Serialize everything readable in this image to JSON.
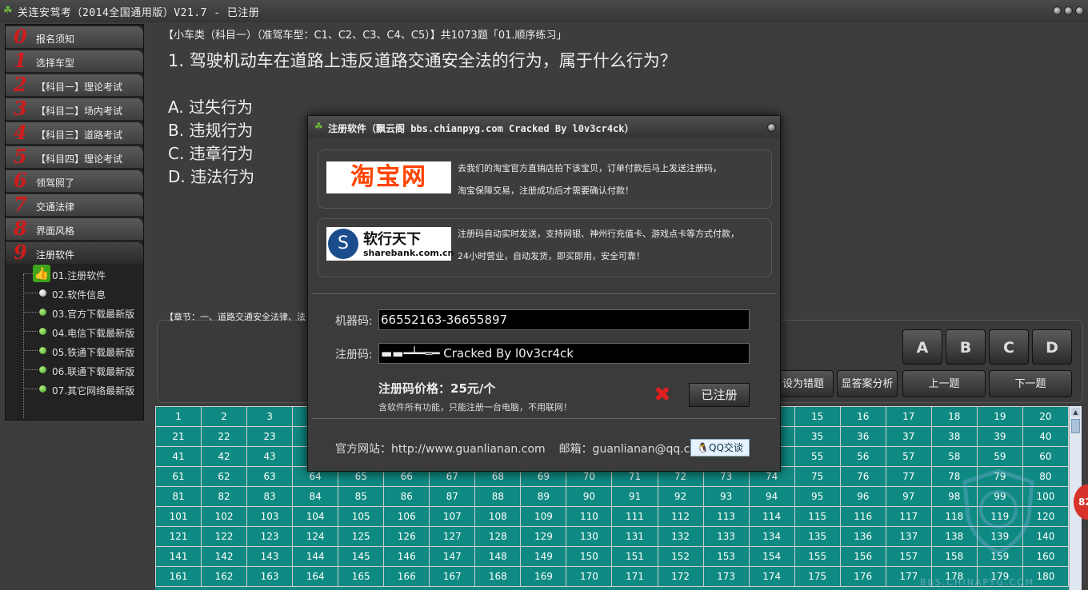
{
  "window": {
    "title": "关连安驾考（2014全国通用版）V21.7 - 已注册"
  },
  "sidebar": {
    "items": [
      {
        "num": "0",
        "label": "报名须知"
      },
      {
        "num": "1",
        "label": "选择车型"
      },
      {
        "num": "2",
        "label": "【科目一】理论考试"
      },
      {
        "num": "3",
        "label": "【科目二】场内考试"
      },
      {
        "num": "4",
        "label": "【科目三】道路考试"
      },
      {
        "num": "5",
        "label": "【科目四】理论考试"
      },
      {
        "num": "6",
        "label": "领驾照了"
      },
      {
        "num": "7",
        "label": "交通法律"
      },
      {
        "num": "8",
        "label": "界面风格"
      },
      {
        "num": "9",
        "label": "注册软件"
      }
    ],
    "subitems": [
      "01.注册软件",
      "02.软件信息",
      "03.官方下载最新版",
      "04.电信下载最新版",
      "05.铁通下载最新版",
      "06.联通下载最新版",
      "07.其它网络最新版"
    ]
  },
  "question": {
    "header": "【小车类（科目一）（准驾车型：C1、C2、C3、C4、C5）】共1073题「01.顺序练习」",
    "text": "1. 驾驶机动车在道路上违反道路交通安全法的行为，属于什么行为？",
    "options": [
      "A. 过失行为",
      "B. 违规行为",
      "C. 违章行为",
      "D. 违法行为"
    ],
    "chapter": "【章节：一、道路交通安全法律、法"
  },
  "answer_buttons": [
    "A",
    "B",
    "C",
    "D"
  ],
  "action_buttons": {
    "mark_wrong": "设为错题",
    "show_analysis": "显答案分析",
    "prev": "上一题",
    "next": "下一题"
  },
  "grid": {
    "start": 1,
    "end": 180,
    "columns": 20
  },
  "badge": {
    "text": "82"
  },
  "watermark": {
    "text": "BBS.CHINAPYG.COM"
  },
  "dialog": {
    "title": "注册软件（飘云阁 bbs.chianpyg.com Cracked By l0v3cr4ck）",
    "taobao_logo": "淘宝网",
    "taobao_line1": "去我们的淘宝官方直销店拍下该宝贝，订单付款后马上发送注册码，",
    "taobao_line2": "淘宝保障交易，注册成功后才需要确认付款！",
    "sharebank_logo_cn": "软行天下",
    "sharebank_logo_en": "sharebank.com.cn",
    "sharebank_line1": "注册码自动实时发送，支持网银、神州行充值卡、游戏点卡等方式付款，",
    "sharebank_line2": "24小时营业，自动发货，即买即用，安全可靠！",
    "machine_label": "机器码:",
    "machine_code": "66552163-36655897",
    "reg_label": "注册码:",
    "reg_code": "▬▬━┷━═━ Cracked By l0v3cr4ck",
    "price": "注册码价格：25元/个",
    "price_note": "含软件所有功能，只能注册一台电脑，不用联网！",
    "register_button": "已注册",
    "website": "官方网站：http://www.guanlianan.com",
    "email": "邮箱：guanlianan@qq.com",
    "qq_button": "QQ交谈"
  },
  "colors": {
    "grid": "#0f8a82",
    "accent_red": "#d21b1b",
    "bg": "#3d3d3d"
  }
}
